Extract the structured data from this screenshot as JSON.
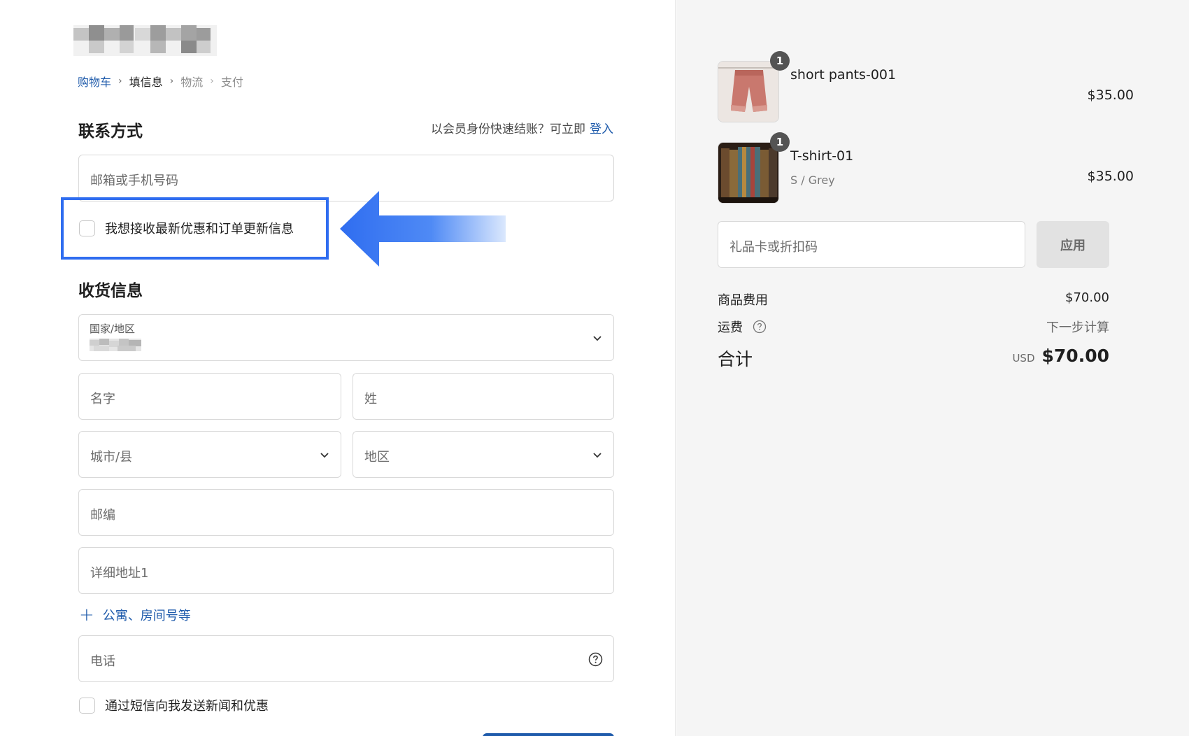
{
  "breadcrumb": {
    "cart": "购物车",
    "info": "填信息",
    "shipping": "物流",
    "payment": "支付"
  },
  "contact": {
    "title": "联系方式",
    "member_prompt": "以会员身份快速结账？可立即",
    "login_link": "登入",
    "email_placeholder": "邮箱或手机号码",
    "newsletter_label": "我想接收最新优惠和订单更新信息"
  },
  "delivery": {
    "title": "收货信息",
    "country_label": "国家/地区",
    "first_name_placeholder": "名字",
    "last_name_placeholder": "姓",
    "city_placeholder": "城市/县",
    "region_placeholder": "地区",
    "postal_placeholder": "邮编",
    "address_placeholder": "详细地址1",
    "add_apartment_label": "公寓、房间号等",
    "phone_placeholder": "电话",
    "sms_label": "通过短信向我发送新闻和优惠"
  },
  "cart": {
    "items": [
      {
        "name": "short pants-001",
        "variant": "",
        "price": "$35.00",
        "quantity": "1"
      },
      {
        "name": "T-shirt-01",
        "variant": "S / Grey",
        "price": "$35.00",
        "quantity": "1"
      }
    ],
    "gift_placeholder": "礼品卡或折扣码",
    "apply_label": "应用"
  },
  "summary": {
    "subtotal_label": "商品费用",
    "subtotal_value": "$70.00",
    "shipping_label": "运费",
    "shipping_value": "下一步计算",
    "total_label": "合计",
    "total_currency": "USD",
    "total_value": "$70.00"
  },
  "colors": {
    "accent": "#1f5bab",
    "highlight": "#2f6df0",
    "sidebar_bg": "#f5f5f5"
  }
}
